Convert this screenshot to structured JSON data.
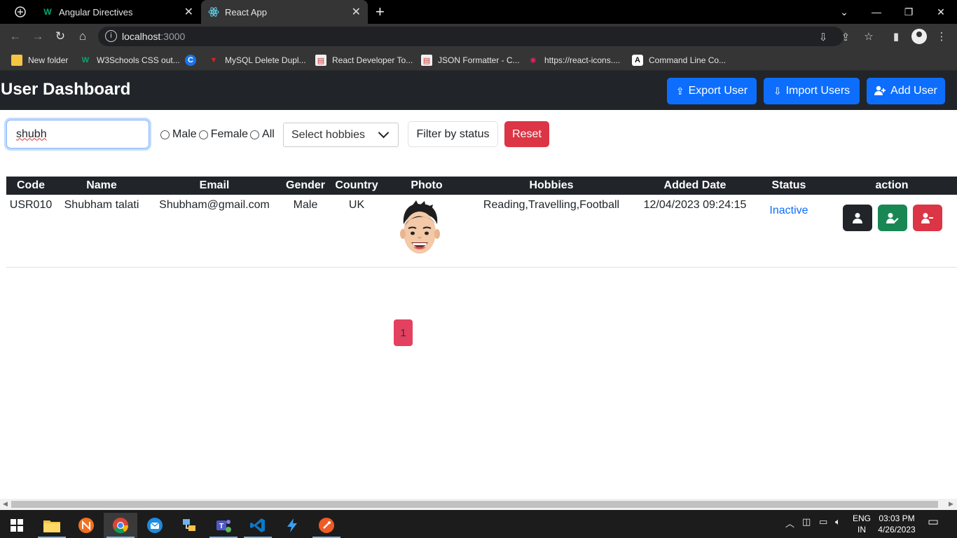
{
  "browser": {
    "tabs": [
      {
        "title": "Angular Directives",
        "favicon": "W"
      },
      {
        "title": "React App",
        "favicon": "react-icon"
      }
    ],
    "address": {
      "host": "localhost",
      "port": ":3000"
    },
    "bookmarks": [
      {
        "label": "New folder"
      },
      {
        "label": "W3Schools CSS out..."
      },
      {
        "label": ""
      },
      {
        "label": "MySQL Delete Dupl..."
      },
      {
        "label": "React Developer To..."
      },
      {
        "label": "JSON Formatter - C..."
      },
      {
        "label": "https://react-icons...."
      },
      {
        "label": "Command Line Co..."
      }
    ]
  },
  "app": {
    "title": "User Dashboard",
    "header_buttons": {
      "export": "Export User",
      "import": "Import Users",
      "add": "Add User"
    },
    "filters": {
      "search_value": "shubh",
      "gender_options": [
        "Male",
        "Female",
        "All"
      ],
      "hobbies_placeholder": "Select hobbies",
      "status_placeholder": "Filter by status",
      "reset": "Reset"
    },
    "table": {
      "columns": [
        "Code",
        "Name",
        "Email",
        "Gender",
        "Country",
        "Photo",
        "Hobbies",
        "Added Date",
        "Status",
        "action"
      ],
      "rows": [
        {
          "code": "USR010",
          "name": "Shubham talati",
          "email": "Shubham@gmail.com",
          "gender": "Male",
          "country": "UK",
          "hobbies": "Reading,Travelling,Football",
          "added": "12/04/2023 09:24:15",
          "status": "Inactive"
        }
      ]
    },
    "pagination": {
      "current": "1"
    }
  },
  "taskbar": {
    "lang": [
      "ENG",
      "IN"
    ],
    "time": "03:03 PM",
    "date": "4/26/2023"
  },
  "colors": {
    "primary": "#0d6efd",
    "danger": "#dc3545",
    "success": "#198754",
    "dark": "#212529",
    "page": "#e4405f"
  }
}
